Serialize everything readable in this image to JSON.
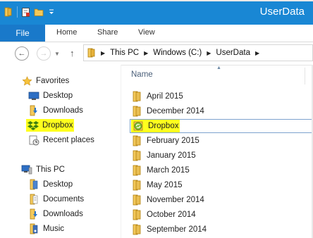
{
  "window": {
    "title": "UserData"
  },
  "ribbon": {
    "tabs": [
      "File",
      "Home",
      "Share",
      "View"
    ]
  },
  "address": {
    "crumbs": [
      "This PC",
      "Windows (C:)",
      "UserData"
    ]
  },
  "nav": {
    "favorites_label": "Favorites",
    "favorites": [
      "Desktop",
      "Downloads",
      "Dropbox",
      "Recent places"
    ],
    "thispc_label": "This PC",
    "thispc": [
      "Desktop",
      "Documents",
      "Downloads",
      "Music"
    ]
  },
  "files": {
    "column_name": "Name",
    "items": [
      "April 2015",
      "December 2014",
      "Dropbox",
      "February 2015",
      "January 2015",
      "March 2015",
      "May 2015",
      "November 2014",
      "October 2014",
      "September 2014"
    ]
  },
  "colors": {
    "titlebar": "#1987d4",
    "file_tab": "#1979ca",
    "highlight": "#ffff1e",
    "folder": "#e9be52",
    "dropbox": "#5c9a14"
  }
}
